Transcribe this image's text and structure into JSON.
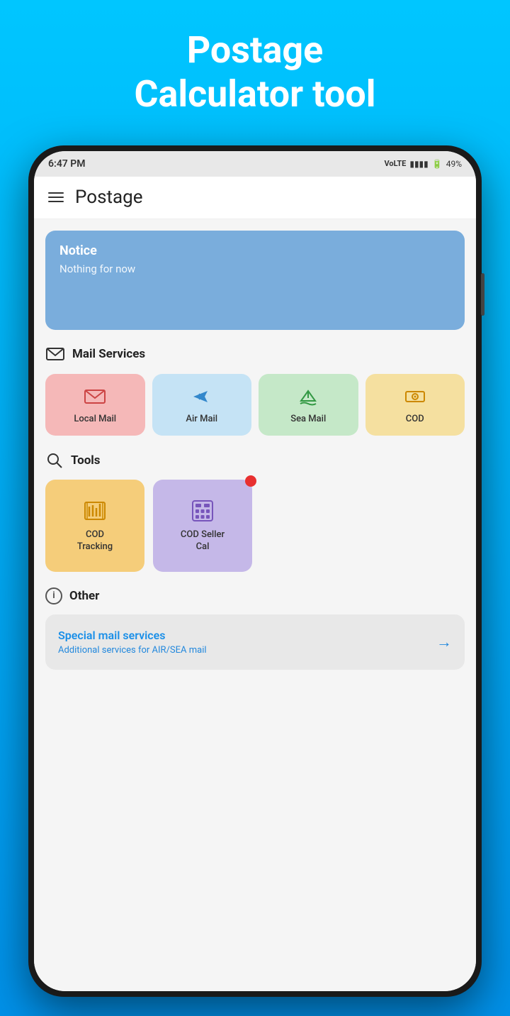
{
  "hero": {
    "title": "Postage\nCalculator tool"
  },
  "status_bar": {
    "time": "6:47 PM",
    "signal": "Vo LTE",
    "battery": "49%"
  },
  "header": {
    "title": "Postage"
  },
  "notice": {
    "title": "Notice",
    "body": "Nothing for now"
  },
  "mail_services": {
    "section_label": "Mail Services",
    "items": [
      {
        "id": "local-mail",
        "label": "Local Mail"
      },
      {
        "id": "air-mail",
        "label": "Air Mail"
      },
      {
        "id": "sea-mail",
        "label": "Sea Mail"
      },
      {
        "id": "cod",
        "label": "COD"
      }
    ]
  },
  "tools": {
    "section_label": "Tools",
    "items": [
      {
        "id": "cod-tracking",
        "label": "COD\nTracking"
      },
      {
        "id": "cod-seller-cal",
        "label": "COD Seller\nCal"
      }
    ]
  },
  "other": {
    "section_label": "Other",
    "special_services": {
      "title": "Special mail services",
      "subtitle": "Additional services for AIR/SEA mail"
    }
  }
}
